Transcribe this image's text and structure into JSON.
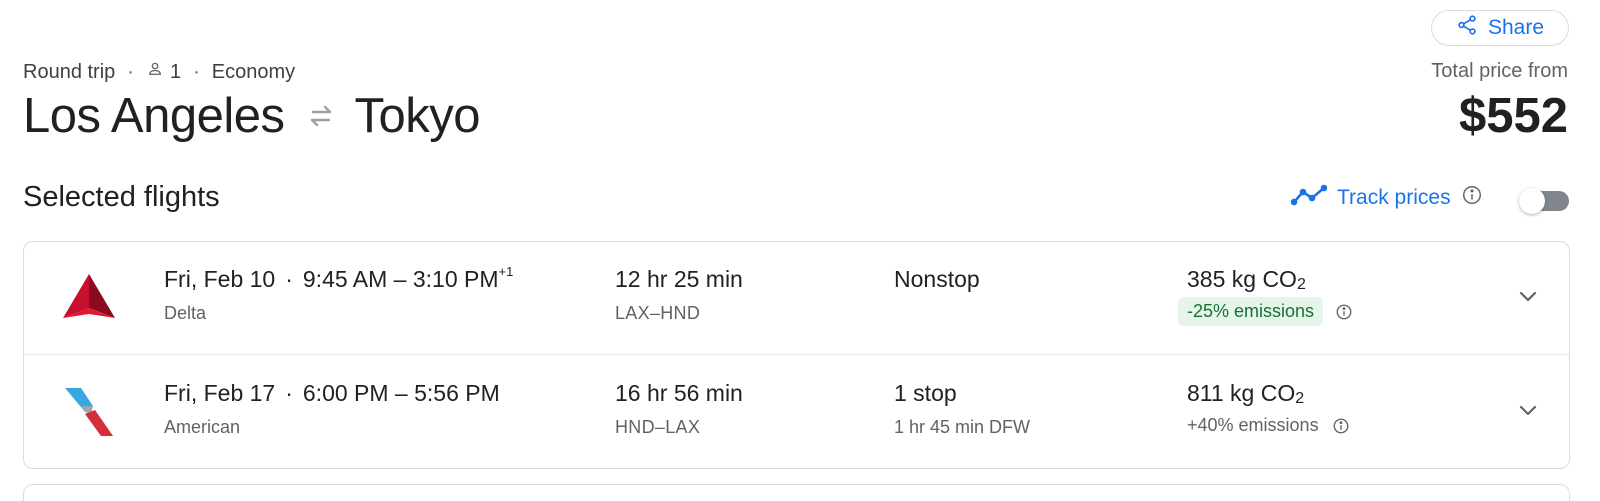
{
  "header": {
    "share_label": "Share",
    "trip_type": "Round trip",
    "passengers": "1",
    "cabin": "Economy",
    "origin": "Los Angeles",
    "destination": "Tokyo",
    "total_label": "Total price from",
    "total_price": "$552"
  },
  "section": {
    "title": "Selected flights",
    "track_label": "Track prices",
    "track_enabled": false
  },
  "flights": [
    {
      "date": "Fri, Feb 10",
      "time_range": "9:45 AM – 3:10 PM",
      "day_offset": "+1",
      "airline": "Delta",
      "duration": "12 hr 25 min",
      "airports": "LAX–HND",
      "stops": "Nonstop",
      "layover": "",
      "co2_value": "385 kg CO",
      "co2_sub": "2",
      "emissions": "-25% emissions",
      "emissions_highlight": true,
      "logo": "delta-logo-icon"
    },
    {
      "date": "Fri, Feb 17",
      "time_range": "6:00 PM – 5:56 PM",
      "day_offset": "",
      "airline": "American",
      "duration": "16 hr 56 min",
      "airports": "HND–LAX",
      "stops": "1 stop",
      "layover": "1 hr 45 min DFW",
      "co2_value": "811 kg CO",
      "co2_sub": "2",
      "emissions": "+40% emissions",
      "emissions_highlight": false,
      "logo": "american-logo-icon"
    }
  ],
  "colors": {
    "accent": "#1a73e8",
    "text_primary": "#202124",
    "text_secondary": "#5f6368",
    "emissions_good_bg": "#e6f4ea",
    "emissions_good_text": "#137333",
    "border": "#dadce0"
  }
}
